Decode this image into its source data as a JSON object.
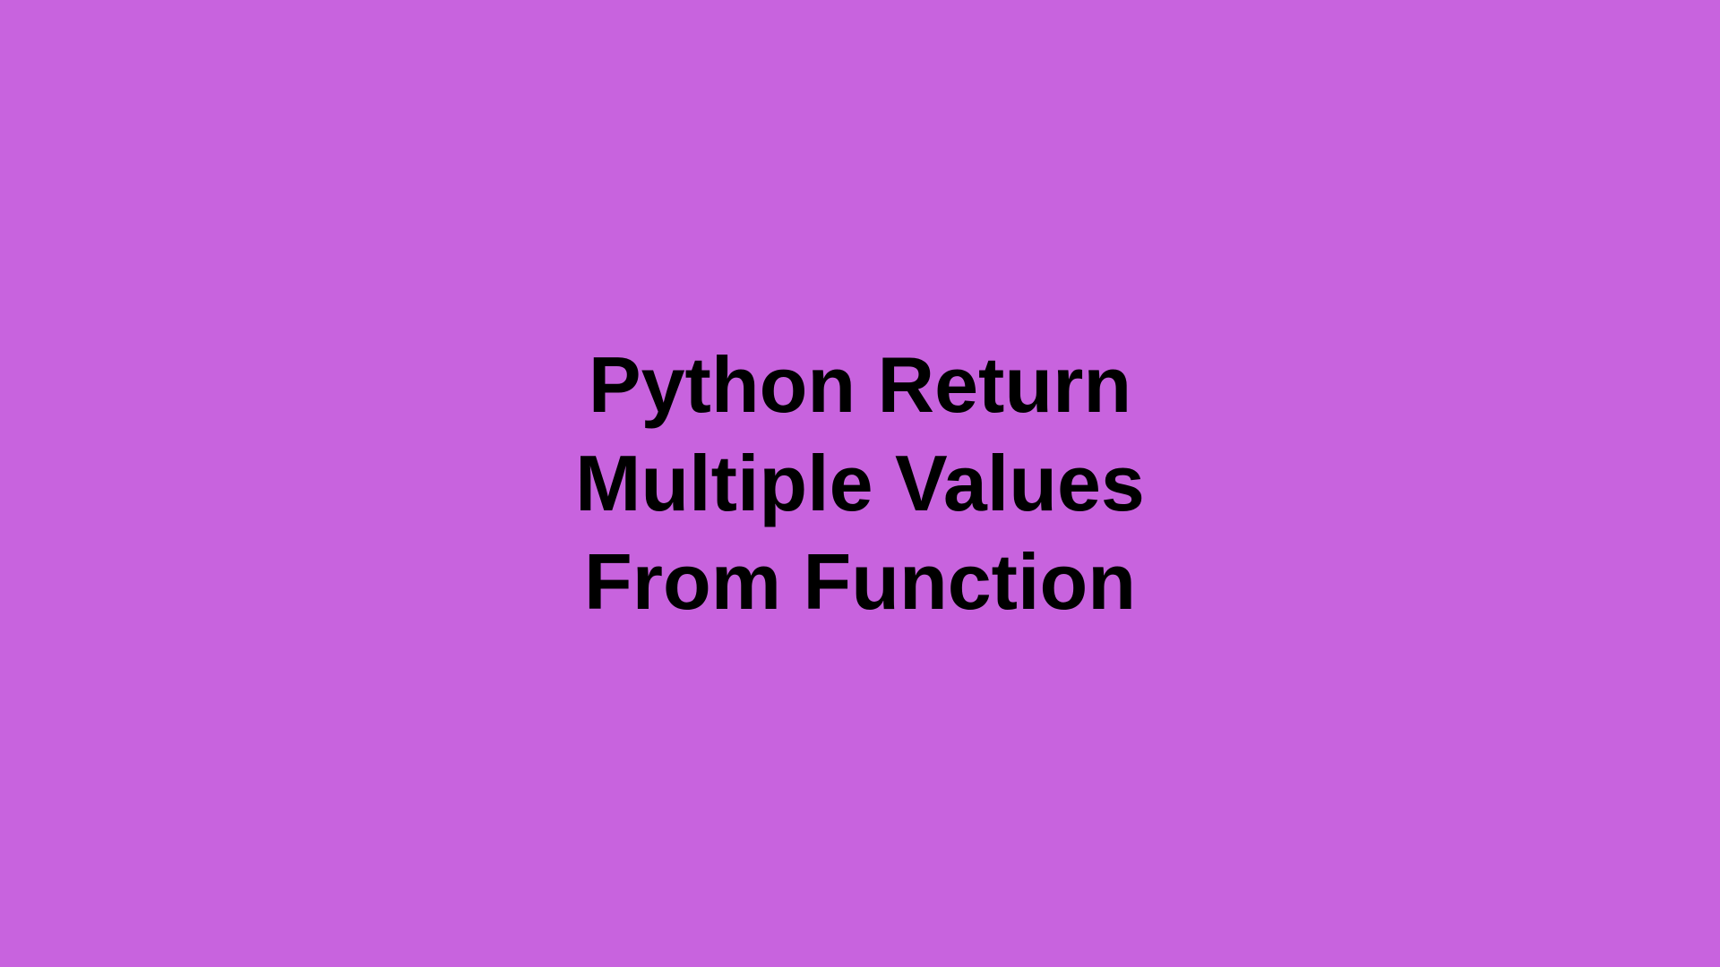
{
  "main": {
    "title_line1": "Python Return",
    "title_line2": "Multiple Values",
    "title_line3": "From Function"
  },
  "colors": {
    "background": "#c863de",
    "text": "#000000"
  }
}
